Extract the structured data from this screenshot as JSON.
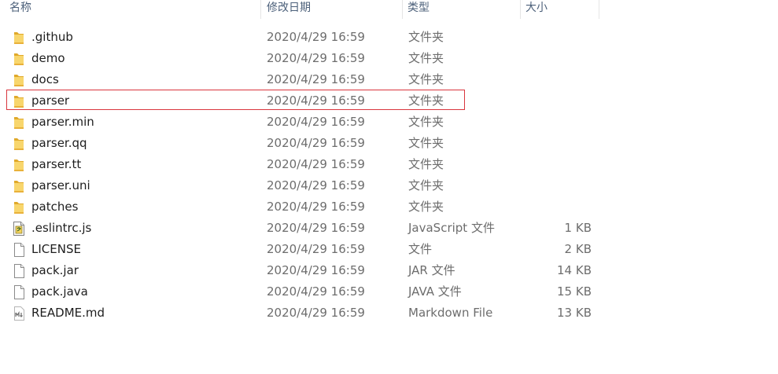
{
  "columns": {
    "name": "名称",
    "date": "修改日期",
    "type": "类型",
    "size": "大小"
  },
  "files": [
    {
      "name": ".github",
      "date": "2020/4/29 16:59",
      "type": "文件夹",
      "size": "",
      "icon": "folder-icon"
    },
    {
      "name": "demo",
      "date": "2020/4/29 16:59",
      "type": "文件夹",
      "size": "",
      "icon": "folder-icon"
    },
    {
      "name": "docs",
      "date": "2020/4/29 16:59",
      "type": "文件夹",
      "size": "",
      "icon": "folder-icon"
    },
    {
      "name": "parser",
      "date": "2020/4/29 16:59",
      "type": "文件夹",
      "size": "",
      "icon": "folder-icon",
      "highlighted": true
    },
    {
      "name": "parser.min",
      "date": "2020/4/29 16:59",
      "type": "文件夹",
      "size": "",
      "icon": "folder-icon"
    },
    {
      "name": "parser.qq",
      "date": "2020/4/29 16:59",
      "type": "文件夹",
      "size": "",
      "icon": "folder-icon"
    },
    {
      "name": "parser.tt",
      "date": "2020/4/29 16:59",
      "type": "文件夹",
      "size": "",
      "icon": "folder-icon"
    },
    {
      "name": "parser.uni",
      "date": "2020/4/29 16:59",
      "type": "文件夹",
      "size": "",
      "icon": "folder-icon"
    },
    {
      "name": "patches",
      "date": "2020/4/29 16:59",
      "type": "文件夹",
      "size": "",
      "icon": "folder-icon"
    },
    {
      "name": ".eslintrc.js",
      "date": "2020/4/29 16:59",
      "type": "JavaScript 文件",
      "size": "1 KB",
      "icon": "javascript-file-icon"
    },
    {
      "name": "LICENSE",
      "date": "2020/4/29 16:59",
      "type": "文件",
      "size": "2 KB",
      "icon": "file-icon"
    },
    {
      "name": "pack.jar",
      "date": "2020/4/29 16:59",
      "type": "JAR 文件",
      "size": "14 KB",
      "icon": "file-icon"
    },
    {
      "name": "pack.java",
      "date": "2020/4/29 16:59",
      "type": "JAVA 文件",
      "size": "15 KB",
      "icon": "file-icon"
    },
    {
      "name": "README.md",
      "date": "2020/4/29 16:59",
      "type": "Markdown File",
      "size": "13 KB",
      "icon": "markdown-file-icon"
    }
  ],
  "colors": {
    "highlight_border": "#d9363e",
    "folder": "#f4c54a",
    "header_text": "#4c607a"
  }
}
